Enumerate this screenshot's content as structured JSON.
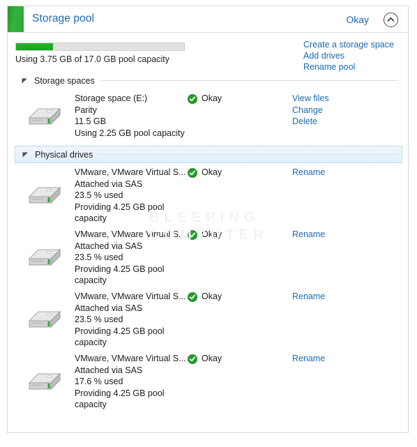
{
  "window": {
    "title": "Storage pool",
    "status": "Okay",
    "collapse_icon": "chevron-up-icon",
    "pool_swatch_color": "#2aa636"
  },
  "capacity": {
    "used_gb": 3.75,
    "total_gb": 17.0,
    "percent_used": 22,
    "label": "Using 3.75 GB of 17.0 GB pool capacity",
    "fill_color": "#1da827"
  },
  "pool_actions": [
    {
      "label": "Create a storage space",
      "name": "create-a-storage-space-link"
    },
    {
      "label": "Add drives",
      "name": "add-drives-link"
    },
    {
      "label": "Rename pool",
      "name": "rename-pool-link"
    }
  ],
  "sections": {
    "storage_spaces": {
      "label": "Storage spaces",
      "expanded": true,
      "highlighted": false
    },
    "physical_drives": {
      "label": "Physical drives",
      "expanded": true,
      "highlighted": true
    }
  },
  "storage_spaces": [
    {
      "name": "Storage space (E:)",
      "resiliency": "Parity",
      "size": "11.5 GB",
      "usage": "Using 2.25 GB pool capacity",
      "status": "Okay",
      "status_icon": "green-check-icon",
      "actions": [
        {
          "label": "View files",
          "name": "view-files-link"
        },
        {
          "label": "Change",
          "name": "change-link"
        },
        {
          "label": "Delete",
          "name": "delete-link"
        }
      ]
    }
  ],
  "physical_drives": [
    {
      "name": "VMware, VMware Virtual S...",
      "attachment": "Attached via SAS",
      "used": "23.5 % used",
      "providing": "Providing 4.25 GB pool capacity",
      "status": "Okay",
      "status_icon": "green-check-icon",
      "actions": [
        {
          "label": "Rename",
          "name": "rename-link"
        }
      ]
    },
    {
      "name": "VMware, VMware Virtual S...",
      "attachment": "Attached via SAS",
      "used": "23.5 % used",
      "providing": "Providing 4.25 GB pool capacity",
      "status": "Okay",
      "status_icon": "green-check-icon",
      "actions": [
        {
          "label": "Rename",
          "name": "rename-link"
        }
      ]
    },
    {
      "name": "VMware, VMware Virtual S...",
      "attachment": "Attached via SAS",
      "used": "23.5 % used",
      "providing": "Providing 4.25 GB pool capacity",
      "status": "Okay",
      "status_icon": "green-check-icon",
      "actions": [
        {
          "label": "Rename",
          "name": "rename-link"
        }
      ]
    },
    {
      "name": "VMware, VMware Virtual S...",
      "attachment": "Attached via SAS",
      "used": "17.6 % used",
      "providing": "Providing 4.25 GB pool capacity",
      "status": "Okay",
      "status_icon": "green-check-icon",
      "actions": [
        {
          "label": "Rename",
          "name": "rename-link"
        }
      ]
    }
  ],
  "watermark": {
    "line1": "BLEEPING",
    "line2": "COMPUTER"
  }
}
